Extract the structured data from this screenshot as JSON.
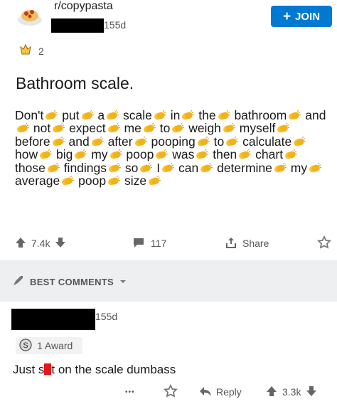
{
  "post": {
    "subreddit": "r/copypasta",
    "age": "155d",
    "join_label": "JOIN",
    "award_count": "2",
    "title": "Bathroom scale.",
    "body_words": [
      "Don't",
      "put",
      "a",
      "scale",
      "in",
      "the",
      "bathroom",
      "and",
      "not",
      "expect",
      "me",
      "to",
      "weigh",
      "myself",
      "before",
      "and",
      "after",
      "pooping",
      "to",
      "calculate",
      "how",
      "big",
      "my",
      "poop",
      "was",
      "then",
      "chart",
      "those",
      "findings",
      "so",
      "I",
      "can",
      "determine",
      "my",
      "average",
      "poop",
      "size"
    ],
    "upvotes": "7.4k",
    "comments": "117",
    "share_label": "Share"
  },
  "comments_header": {
    "label": "BEST COMMENTS"
  },
  "comment": {
    "age": "155d",
    "award_label": "1 Award",
    "text_before": "Just s",
    "text_after": "t on the scale dumbass",
    "more": "•••",
    "reply_label": "Reply",
    "votes": "3.3k"
  },
  "colors": {
    "accent": "#0079d3",
    "band": "#edeff1",
    "clap": "#f7c12e",
    "redact_red": "#e8141c"
  },
  "icons": [
    "clap-icon",
    "arrow-up-icon",
    "arrow-down-icon",
    "comment-icon",
    "share-icon",
    "award-icon",
    "rocket-icon",
    "reply-icon",
    "silver-award-icon"
  ]
}
